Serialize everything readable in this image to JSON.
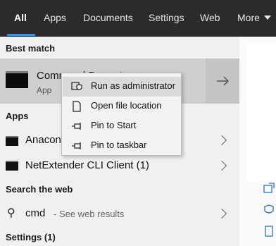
{
  "tabs": [
    {
      "label": "All",
      "active": true
    },
    {
      "label": "Apps"
    },
    {
      "label": "Documents"
    },
    {
      "label": "Settings"
    },
    {
      "label": "Web"
    },
    {
      "label": "More"
    }
  ],
  "best_match": {
    "heading": "Best match",
    "title": "Command Prompt",
    "subtitle": "App"
  },
  "apps": {
    "heading": "Apps",
    "items": [
      {
        "label": "Anaconda Prompt"
      },
      {
        "label": "NetExtender CLI Client (1)"
      }
    ]
  },
  "web": {
    "heading": "Search the web",
    "query": "cmd",
    "hint": "- See web results"
  },
  "settings": {
    "heading": "Settings (1)"
  },
  "context_menu": [
    {
      "label": "Run as administrator",
      "icon": "shield-icon",
      "hover": true
    },
    {
      "label": "Open file location",
      "icon": "file-icon"
    },
    {
      "label": "Pin to Start",
      "icon": "pin-icon"
    },
    {
      "label": "Pin to taskbar",
      "icon": "pin-icon"
    }
  ],
  "colors": {
    "topbar": "#2b2b2b",
    "accent": "#3b8de0",
    "right_pane_icons": "#2a72c8"
  }
}
